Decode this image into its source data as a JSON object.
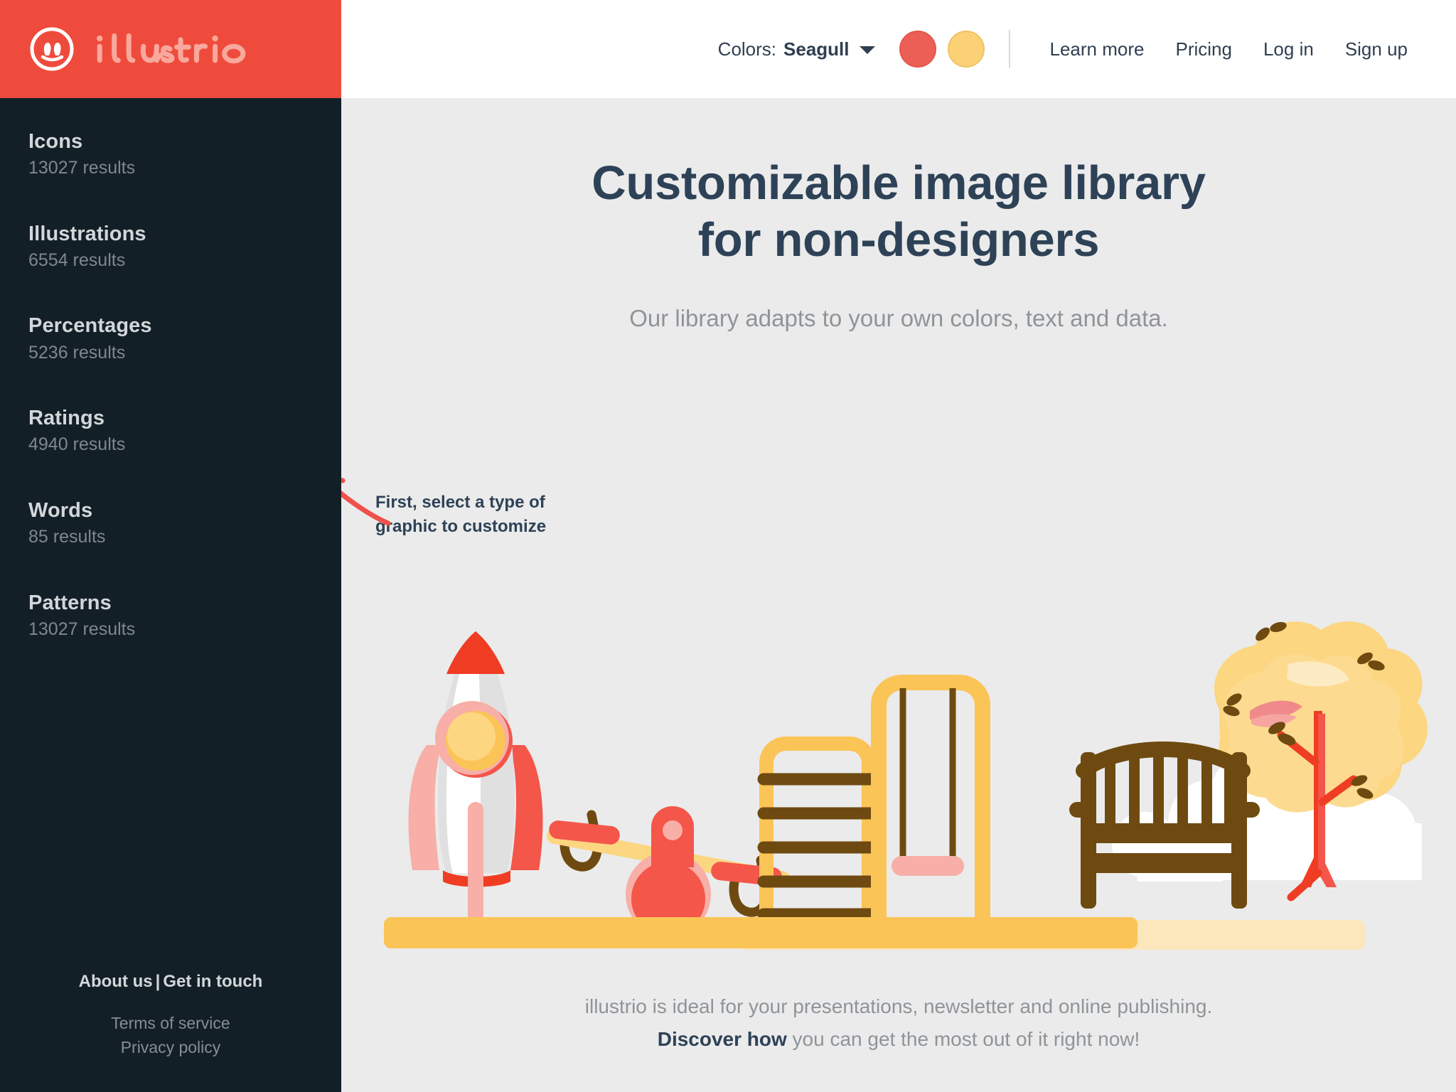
{
  "brand": {
    "name": "illustrio",
    "logo_icon": "illustrio-circle-logo",
    "background": "#ef4b3c"
  },
  "nav": {
    "colors_label": "Colors:",
    "colors_value": "Seagull",
    "caret_icon": "chevron-down-icon",
    "swatches": [
      {
        "name": "swatch-coral",
        "color": "#ec5f56"
      },
      {
        "name": "swatch-amber",
        "color": "#fbd176"
      }
    ],
    "links": [
      {
        "label": "Learn more"
      },
      {
        "label": "Pricing"
      },
      {
        "label": "Log in"
      },
      {
        "label": "Sign up"
      }
    ]
  },
  "sidebar": {
    "items": [
      {
        "label": "Icons",
        "count": "13027 results"
      },
      {
        "label": "Illustrations",
        "count": "6554 results"
      },
      {
        "label": "Percentages",
        "count": "5236 results"
      },
      {
        "label": "Ratings",
        "count": "4940 results"
      },
      {
        "label": "Words",
        "count": "85 results"
      },
      {
        "label": "Patterns",
        "count": "13027 results"
      }
    ],
    "footer": {
      "about": "About us",
      "separator": "|",
      "contact": "Get in touch",
      "terms": "Terms of service",
      "privacy": "Privacy policy"
    }
  },
  "hero": {
    "title_line1": "Customizable image library",
    "title_line2": "for non-designers",
    "subtitle": "Our library adapts to your own colors, text and data.",
    "title_color": "#2e4257"
  },
  "annotation": {
    "line1": "First, select a type of",
    "line2": "graphic to customize",
    "arrow_icon": "curved-arrow-left-icon",
    "arrow_color": "#f0504a"
  },
  "decor": {
    "leaf_coral": "leaf-icon",
    "leaf_amber": "leaf-icon",
    "leaf_coral_color": "#f4705f",
    "leaf_amber_color": "#fbc95f"
  },
  "illustration": {
    "name": "playground-scene",
    "elements": [
      "rocket",
      "seesaw",
      "ladder",
      "swing",
      "bench",
      "tree",
      "clouds",
      "ground"
    ],
    "palette": {
      "red": "#ef3d23",
      "coral": "#f4564a",
      "pink": "#f7afa8",
      "amber": "#fbc456",
      "light_amber": "#fcd680",
      "cream": "#fce7bd",
      "brown": "#6e4a11",
      "white": "#ffffff",
      "gray": "#e0e0e0"
    }
  },
  "tagline": {
    "line1": "illustrio is ideal for your presentations, newsletter and online publishing.",
    "link": "Discover how",
    "line2_rest": " you can get the most out of it right now!"
  }
}
